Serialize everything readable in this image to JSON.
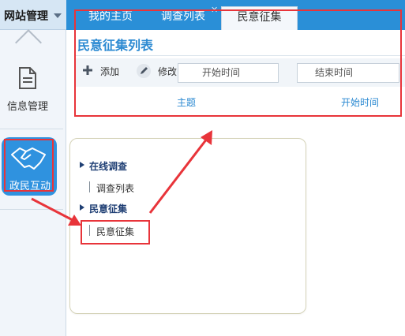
{
  "site_menu": {
    "label": "网站管理"
  },
  "tabs": [
    {
      "label": "我的主页"
    },
    {
      "label": "调查列表"
    },
    {
      "label": "民意征集"
    }
  ],
  "sidebar": {
    "items": [
      {
        "label": "信息管理",
        "icon": "document-icon"
      },
      {
        "label": "政民互动",
        "icon": "handshake-icon"
      }
    ]
  },
  "panel": {
    "title": "民意征集列表",
    "toolbar": {
      "add_label": "添加",
      "edit_label": "修改"
    },
    "filters": {
      "start_placeholder": "开始时间",
      "end_placeholder": "结束时间"
    },
    "columns": [
      "主题",
      "开始时间"
    ]
  },
  "popup": {
    "sections": [
      {
        "title": "在线调查",
        "items": [
          "调查列表"
        ]
      },
      {
        "title": "民意征集",
        "items": [
          "民意征集"
        ]
      }
    ]
  },
  "colors": {
    "accent": "#2a8fd7",
    "highlight": "#e8343a"
  }
}
